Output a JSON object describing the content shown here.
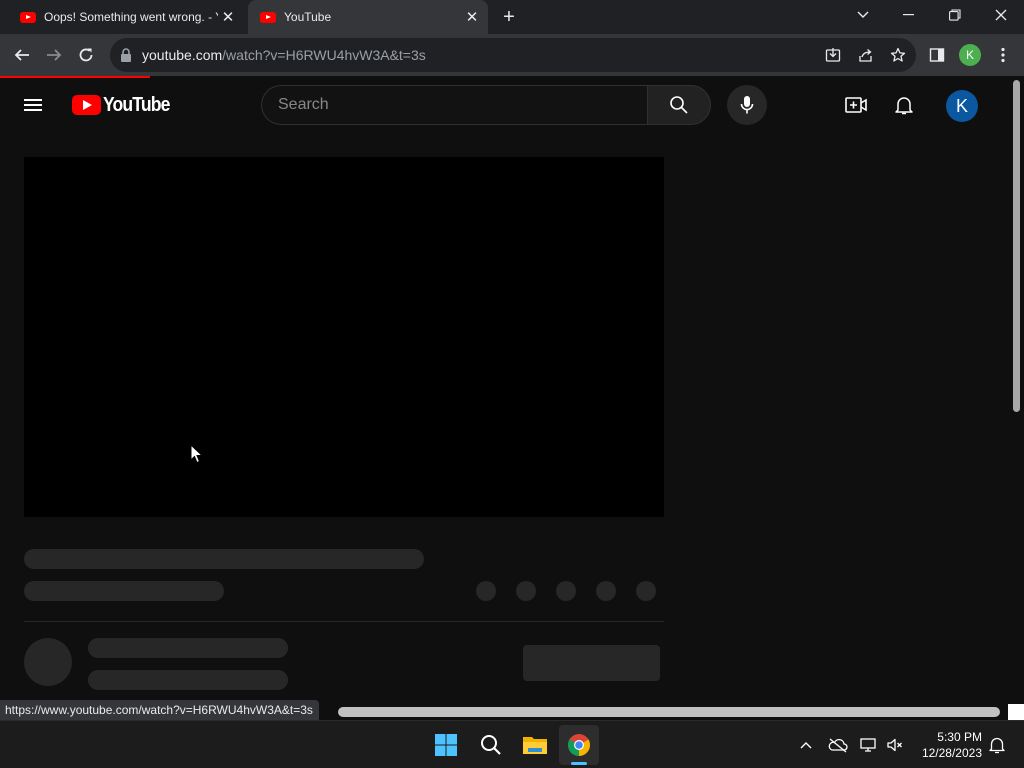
{
  "browser": {
    "tabs": [
      {
        "title": "Oops! Something went wrong. - YouTube",
        "active": false
      },
      {
        "title": "YouTube",
        "active": true
      }
    ],
    "url_host": "youtube.com",
    "url_path": "/watch?v=H6RWU4hvW3A&t=3s",
    "profile_initial": "K",
    "status_url": "https://www.youtube.com/watch?v=H6RWU4hvW3A&t=3s"
  },
  "youtube": {
    "logo_text": "YouTube",
    "search_placeholder": "Search",
    "avatar_initial": "K"
  },
  "taskbar": {
    "time": "5:30 PM",
    "date": "12/28/2023"
  },
  "colors": {
    "yt_red": "#ff0000",
    "yt_bg": "#0f0f0f",
    "avatar_bg": "#0b57a0",
    "chrome_profile": "#4caf50"
  }
}
